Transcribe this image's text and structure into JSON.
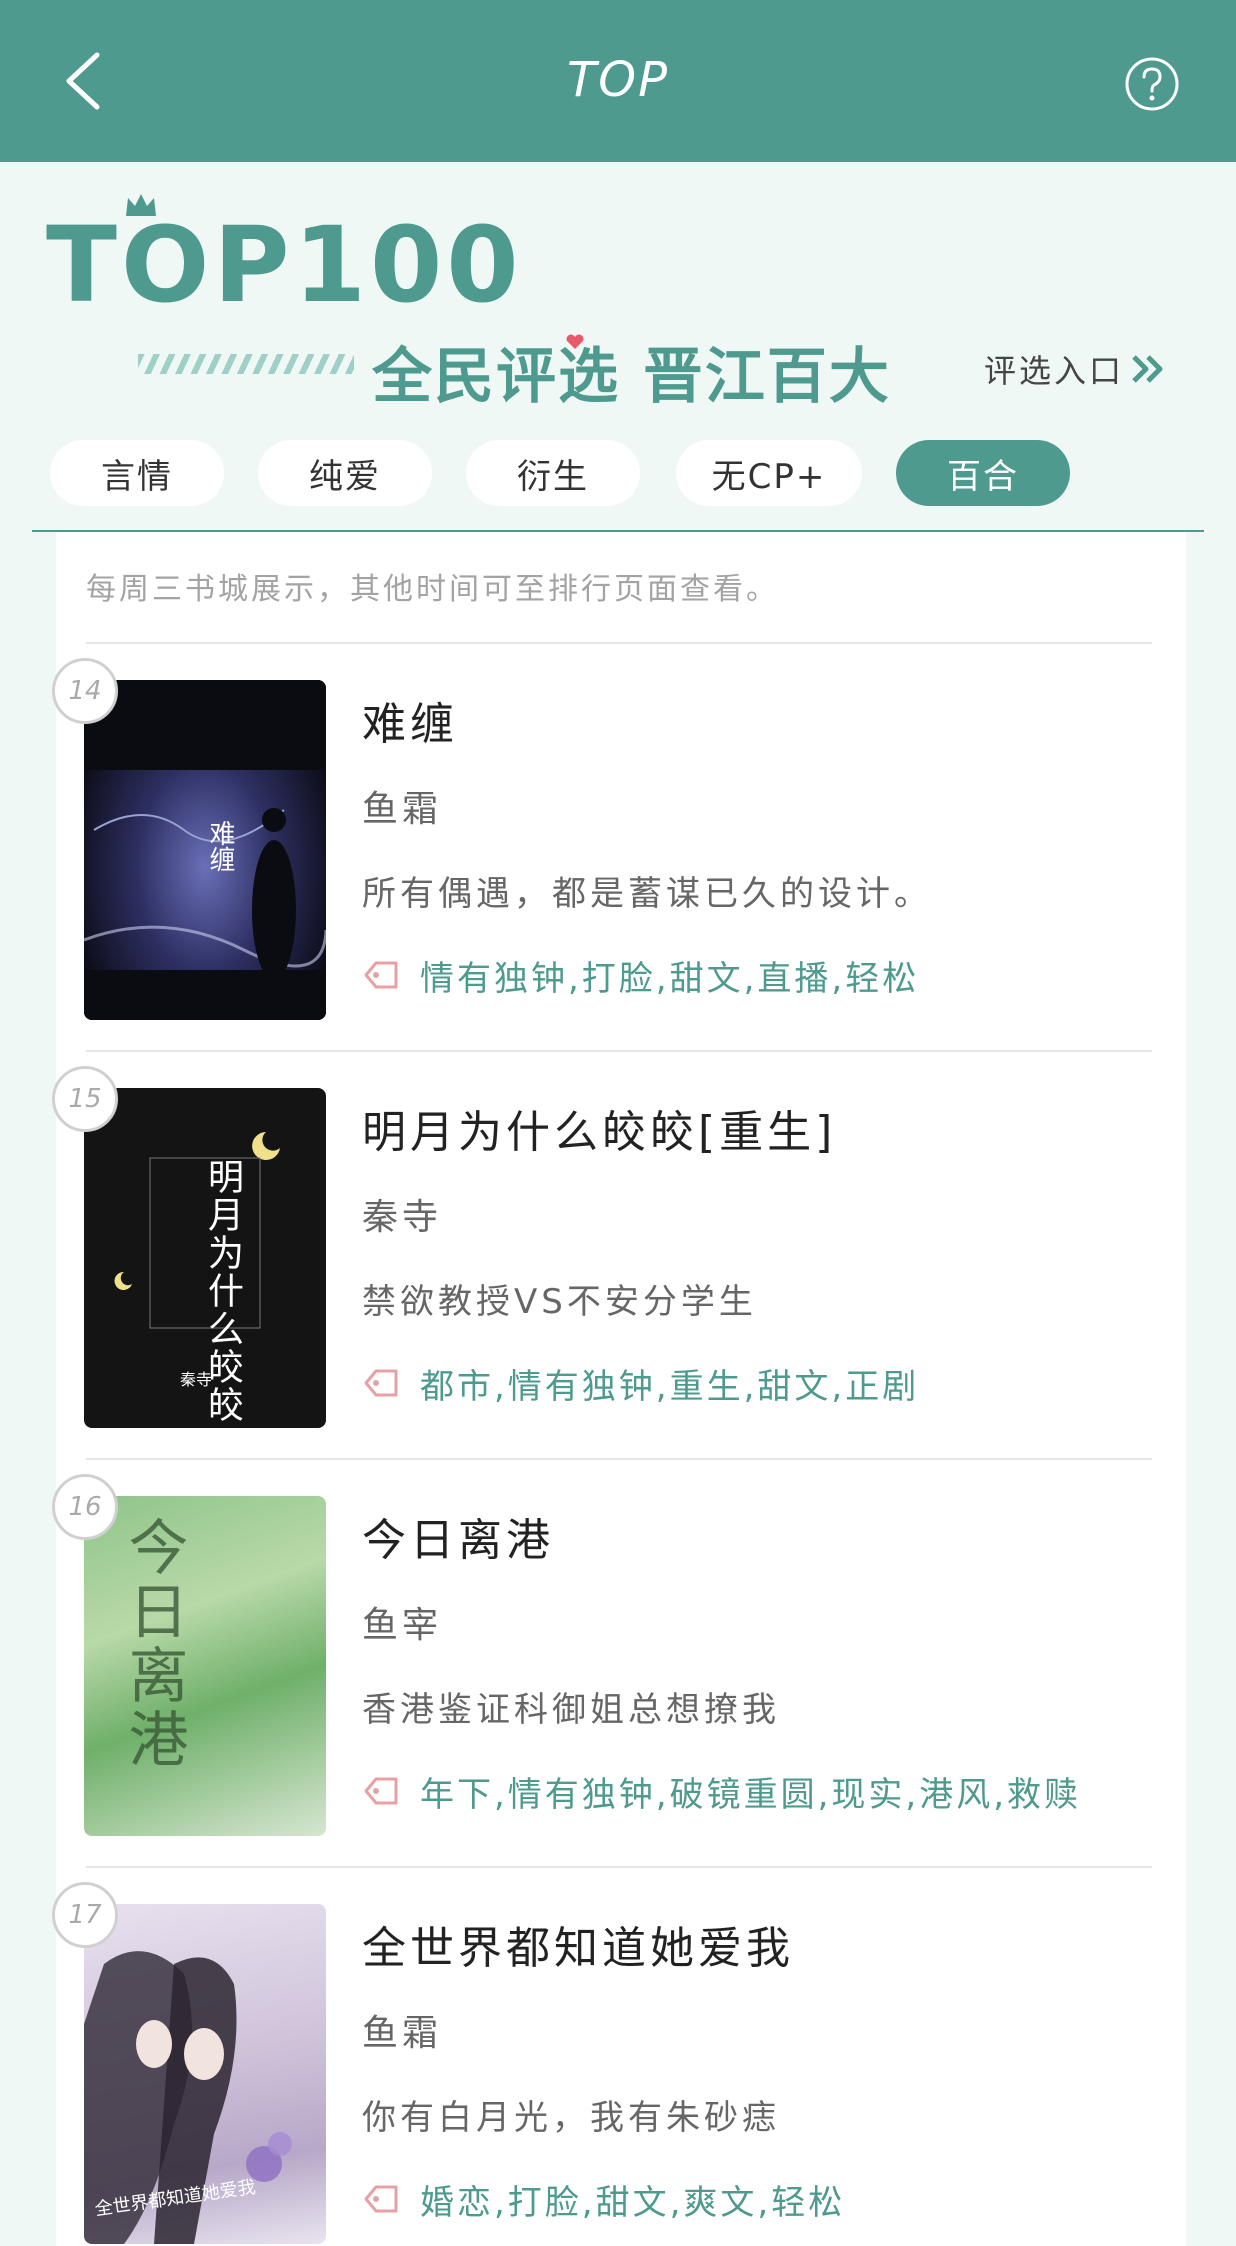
{
  "nav": {
    "title": "TOP",
    "back_icon": "chevron-left-icon",
    "help_icon": "question-circle-icon"
  },
  "banner": {
    "logo_text": "TOP100",
    "slogan": "全民评选 晋江百大",
    "entry_link": "评选入口"
  },
  "tabs": [
    {
      "label": "言情",
      "active": false
    },
    {
      "label": "纯爱",
      "active": false
    },
    {
      "label": "衍生",
      "active": false
    },
    {
      "label": "无CP+",
      "active": false
    },
    {
      "label": "百合",
      "active": true
    }
  ],
  "notice": "每周三书城展示，其他时间可至排行页面查看。",
  "books": [
    {
      "rank": "14",
      "title": "难缠",
      "author": "鱼霜",
      "desc": "所有偶遇，都是蓄谋已久的设计。",
      "tags": "情有独钟,打脸,甜文,直播,轻松",
      "cover_text": "难缠"
    },
    {
      "rank": "15",
      "title": "明月为什么皎皎[重生]",
      "author": "秦寺",
      "desc": "禁欲教授VS不安分学生",
      "tags": "都市,情有独钟,重生,甜文,正剧",
      "cover_text": "明月为什么皎皎",
      "cover_author": "秦寺"
    },
    {
      "rank": "16",
      "title": "今日离港",
      "author": "鱼宰",
      "desc": "香港鉴证科御姐总想撩我",
      "tags": "年下,情有独钟,破镜重圆,现实,港风,救赎",
      "cover_text": "今日离港"
    },
    {
      "rank": "17",
      "title": "全世界都知道她爱我",
      "author": "鱼霜",
      "desc": "你有白月光，我有朱砂痣",
      "tags": "婚恋,打脸,甜文,爽文,轻松",
      "cover_text": "全世界都知道她爱我"
    }
  ],
  "colors": {
    "accent": "#4e9a8f",
    "background": "#f0f8f5",
    "tag_icon": "#e8a0a0"
  }
}
